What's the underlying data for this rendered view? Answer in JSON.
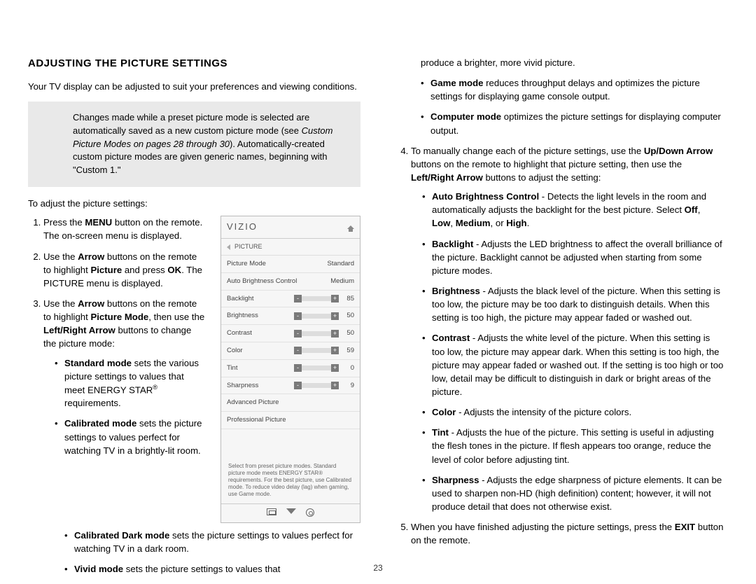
{
  "heading": "ADJUSTING THE PICTURE SETTINGS",
  "intro": "Your TV display can be adjusted to suit your preferences and viewing conditions.",
  "note": {
    "p1": "Changes made while a preset picture mode is selected are automatically saved as a new custom picture mode (see ",
    "em": "Custom Picture Modes on pages 28 through 30",
    "p2": "). Automatically-created custom picture modes are given generic names, beginning with \"Custom 1.\""
  },
  "subhead": "To adjust the picture settings:",
  "steps": {
    "s1a": "Press the ",
    "s1b": "MENU",
    "s1c": " button on the remote. The on-screen menu is displayed.",
    "s2a": "Use the ",
    "s2b": "Arrow",
    "s2c": " buttons on the remote to highlight ",
    "s2d": "Picture",
    "s2e": " and press ",
    "s2f": "OK",
    "s2g": ". The PICTURE menu is displayed.",
    "s3a": "Use the ",
    "s3b": "Arrow",
    "s3c": " buttons on the remote to highlight ",
    "s3d": "Picture Mode",
    "s3e": ", then use the ",
    "s3f": "Left/Right Arrow",
    "s3g": " buttons to change the picture mode:"
  },
  "modes": {
    "std_b": "Standard mode",
    "std_t1": " sets the various picture settings to values that meet ENERGY STAR",
    "std_sup": "®",
    "std_t2": " requirements.",
    "cal_b": "Calibrated mode",
    "cal_t": " sets the picture settings to values perfect for watching TV in a brightly-lit room.",
    "cald_b": "Calibrated Dark mode",
    "cald_t": " sets the picture settings to values perfect for watching TV in a dark room.",
    "viv_b": "Vivid mode",
    "viv_t": " sets the picture settings to values that"
  },
  "col2_top": "produce a brighter, more vivid picture.",
  "game_b": "Game mode",
  "game_t": " reduces throughput delays and optimizes the picture settings for displaying game console output.",
  "comp_b": "Computer mode",
  "comp_t": " optimizes the picture settings for displaying computer output.",
  "step4a": "To manually change each of the picture settings, use the ",
  "step4b": "Up/Down Arrow",
  "step4c": " buttons on the remote to highlight that picture setting, then use the ",
  "step4d": "Left/Right Arrow",
  "step4e": " buttons to adjust the setting:",
  "settings": {
    "abc_b": "Auto Brightness Control",
    "abc_t1": " - Detects the light levels in the room and automatically adjusts the backlight for the best picture. Select ",
    "abc_off": "Off",
    "abc_c1": ", ",
    "abc_low": "Low",
    "abc_c2": ", ",
    "abc_med": "Medium",
    "abc_c3": ", or ",
    "abc_high": "High",
    "abc_dot": ".",
    "bl_b": "Backlight",
    "bl_t": " - Adjusts the LED brightness to affect the overall brilliance of the picture. Backlight cannot be adjusted when starting from some picture modes.",
    "br_b": "Brightness",
    "br_t": " - Adjusts the black level of the picture. When this setting is too low, the picture may be too dark to distinguish details. When this setting is too high, the picture may appear faded or washed out.",
    "ct_b": "Contrast",
    "ct_t": " - Adjusts the white level of the picture. When this setting is too low, the picture may appear dark. When this setting is too high, the picture may appear faded or washed out. If the setting is too high or too low, detail may be difficult to distinguish in dark or bright areas of the picture.",
    "co_b": "Color",
    "co_t": " - Adjusts the intensity of the picture colors.",
    "ti_b": "Tint",
    "ti_t": " - Adjusts the hue of the picture. This setting is useful in adjusting the flesh tones in the picture. If flesh appears too orange, reduce the level of color before adjusting tint.",
    "sh_b": "Sharpness",
    "sh_t": " - Adjusts the edge sharpness of picture elements. It can be used to sharpen non-HD (high definition) content; however, it will not produce detail that does not otherwise exist."
  },
  "step5a": "When you have finished adjusting the picture settings, press the ",
  "step5b": "EXIT",
  "step5c": " button on the remote.",
  "panel": {
    "brand": "VIZIO",
    "section": "PICTURE",
    "rows": {
      "pm_l": "Picture Mode",
      "pm_v": "Standard",
      "abc_l": "Auto Brightness Control",
      "abc_v": "Medium",
      "bl_l": "Backlight",
      "bl_v": "85",
      "br_l": "Brightness",
      "br_v": "50",
      "ct_l": "Contrast",
      "ct_v": "50",
      "co_l": "Color",
      "co_v": "59",
      "ti_l": "Tint",
      "ti_v": "0",
      "sh_l": "Sharpness",
      "sh_v": "9",
      "adv": "Advanced Picture",
      "pro": "Professional Picture"
    },
    "help": "Select from preset picture modes. Standard picture mode meets ENERGY STAR® requirements. For the best picture, use Calibrated mode. To reduce video delay (lag) when gaming, use Game mode."
  },
  "pagenum": "23"
}
